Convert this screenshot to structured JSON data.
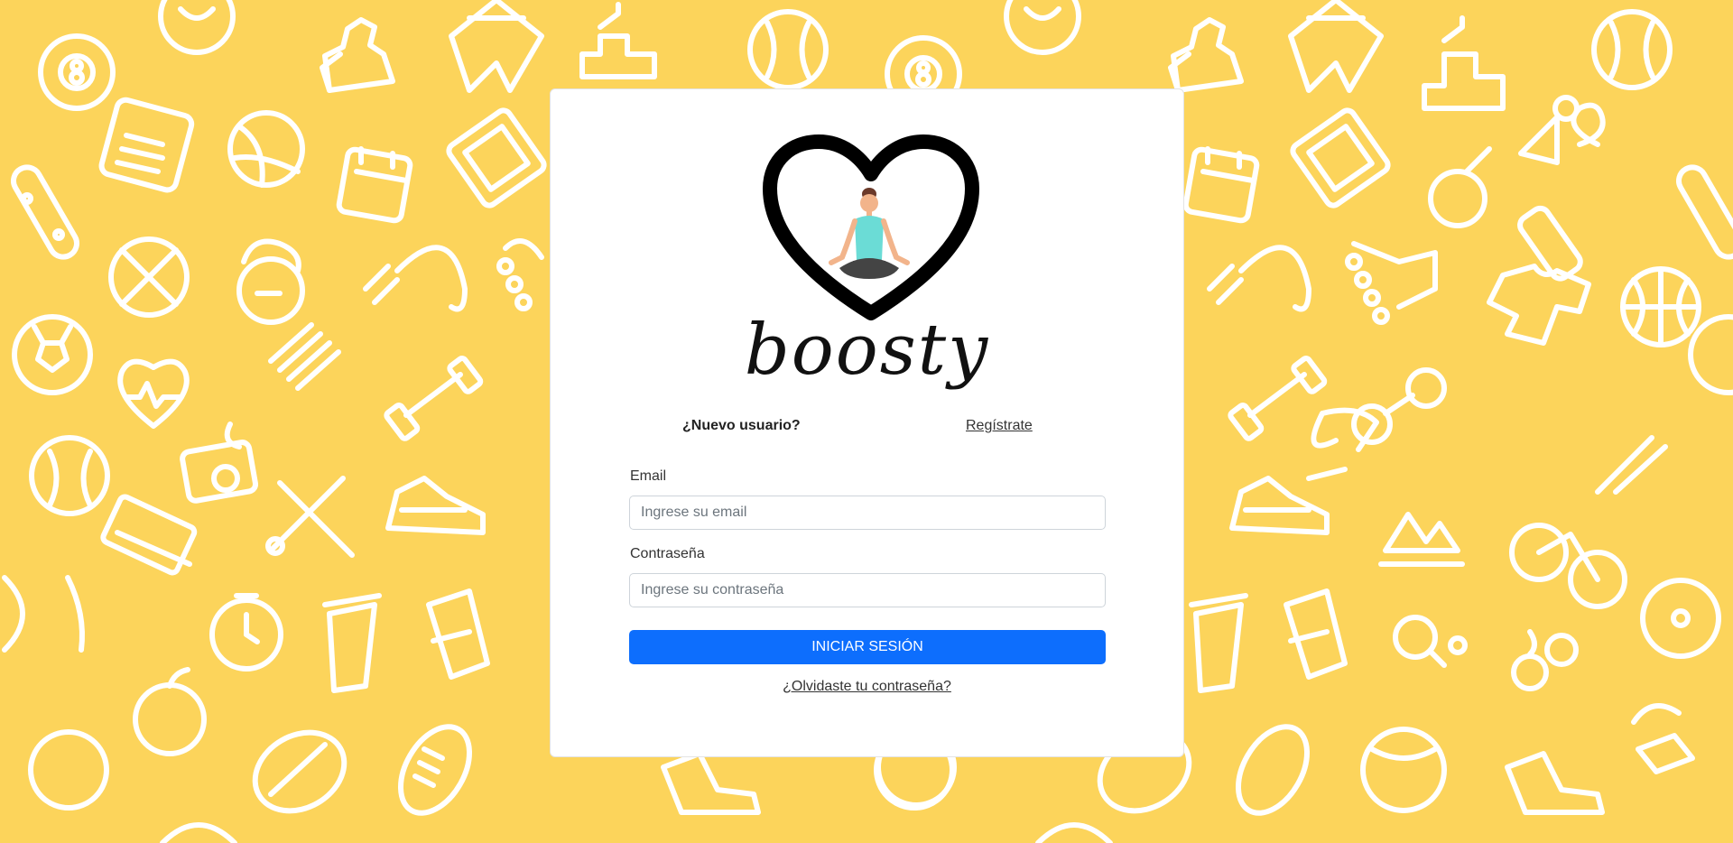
{
  "colors": {
    "background": "#FCD45B",
    "pattern": "#FFFFFF",
    "card": "#FFFFFF",
    "primary_button": "#0D6EFD",
    "yoga_top": "#6BDCD6",
    "yoga_pants": "#444444",
    "skin": "#F2B48B"
  },
  "logo": {
    "icon": "heart-yoga-icon",
    "brand_name": "boosty"
  },
  "register": {
    "prompt": "¿Nuevo usuario?",
    "link_label": "Regístrate"
  },
  "form": {
    "email_label": "Email",
    "email_value": "",
    "email_placeholder": "Ingrese su email",
    "password_label": "Contraseña",
    "password_value": "",
    "password_placeholder": "Ingrese su contraseña",
    "submit_label": "INICIAR SESIÓN",
    "forgot_label": "¿Olvidaste tu contraseña?"
  },
  "background_icons": [
    "billiard-ball-icon",
    "chess-piece-icon",
    "shorts-icon",
    "baseball-icon",
    "podium-icon",
    "scale-icon",
    "volleyball-icon",
    "calendar-icon",
    "skateboard-icon",
    "no-food-icon",
    "kettlebell-icon",
    "jump-rope-icon",
    "soccer-ball-icon",
    "heart-rate-icon",
    "dumbbell-icon",
    "camera-icon",
    "fencing-icon",
    "sneaker-icon",
    "stopwatch-icon",
    "blender-icon",
    "apple-icon",
    "rugby-ball-icon",
    "tennis-ball-icon",
    "basketball-icon",
    "bicycle-icon",
    "t-shirt-icon",
    "shuttlecock-icon",
    "whistle-icon",
    "water-bottle-icon",
    "roller-skate-icon"
  ]
}
